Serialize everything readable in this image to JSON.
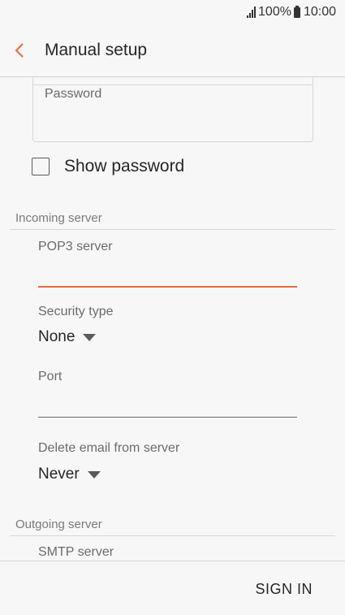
{
  "status_bar": {
    "battery": "100%",
    "time": "10:00",
    "icons": [
      "signal-icon",
      "battery-icon"
    ]
  },
  "app_bar": {
    "back_icon": "chevron-left-icon",
    "title": "Manual setup",
    "accent_color": "#e96b3c"
  },
  "form": {
    "password_label": "Password",
    "show_password_label": "Show password",
    "show_password_checked": false,
    "incoming": {
      "header": "Incoming server",
      "pop3_label": "POP3 server",
      "pop3_value": "",
      "security_label": "Security type",
      "security_value": "None",
      "port_label": "Port",
      "port_value": "",
      "delete_label": "Delete email from server",
      "delete_value": "Never"
    },
    "outgoing": {
      "header": "Outgoing server",
      "smtp_label": "SMTP server"
    }
  },
  "footer": {
    "sign_in_label": "SIGN IN"
  }
}
